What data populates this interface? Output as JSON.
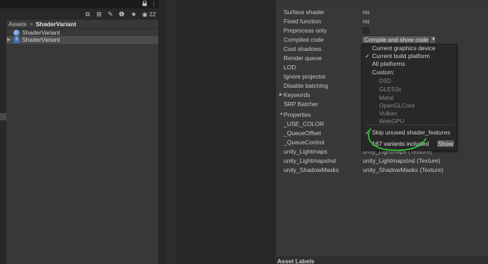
{
  "project": {
    "toolbar_count": "22",
    "breadcrumb": {
      "root": "Assets",
      "separator": ">",
      "current": "ShaderVariant"
    },
    "assets": [
      {
        "label": "ShaderVariant",
        "icon": "shader-variant-collection-icon"
      },
      {
        "label": "ShaderVariant",
        "icon": "shader-icon",
        "selected": true
      }
    ]
  },
  "inspector": {
    "properties": [
      {
        "label": "Surface shader",
        "value": "no"
      },
      {
        "label": "Fixed function",
        "value": "no"
      },
      {
        "label": "Preprocess only",
        "value": ""
      },
      {
        "label": "Compiled code",
        "value": ""
      },
      {
        "label": "Cast shadows",
        "value": ""
      },
      {
        "label": "Render queue",
        "value": ""
      },
      {
        "label": "LOD",
        "value": ""
      },
      {
        "label": "Ignore projector",
        "value": ""
      },
      {
        "label": "Disable batching",
        "value": ""
      },
      {
        "label": "Keywords",
        "value": ""
      },
      {
        "label": "SRP Batcher",
        "value": ""
      },
      {
        "label": "Properties",
        "value": ""
      },
      {
        "label": "_USE_COLOR",
        "value": ""
      },
      {
        "label": "_QueueOffset",
        "value": ""
      },
      {
        "label": "_QueueControl",
        "value": ""
      },
      {
        "label": "unity_Lightmaps",
        "value": "unity_Lightmaps (Texture)"
      },
      {
        "label": "unity_LightmapsInd",
        "value": "unity_LightmapsInd (Texture)"
      },
      {
        "label": "unity_ShadowMasks",
        "value": "unity_ShadowMasks (Texture)"
      }
    ],
    "compile_button": "Compile and show code",
    "bottom_label": "Asset Labels"
  },
  "dropdown": {
    "items": [
      {
        "label": "Current graphics device",
        "checked": false,
        "disabled": false,
        "sub": false
      },
      {
        "label": "Current build platform",
        "checked": true,
        "disabled": false,
        "sub": false
      },
      {
        "label": "All platforms",
        "checked": false,
        "disabled": false,
        "sub": false
      },
      {
        "label": "Custom:",
        "checked": false,
        "disabled": false,
        "sub": false
      },
      {
        "label": "D3D",
        "checked": false,
        "disabled": true,
        "sub": true
      },
      {
        "label": "GLES3x",
        "checked": false,
        "disabled": true,
        "sub": true
      },
      {
        "label": "Metal",
        "checked": false,
        "disabled": true,
        "sub": true
      },
      {
        "label": "OpenGLCore",
        "checked": false,
        "disabled": true,
        "sub": true
      },
      {
        "label": "Vulkan",
        "checked": false,
        "disabled": true,
        "sub": true
      },
      {
        "label": "WebGPU",
        "checked": false,
        "disabled": true,
        "sub": true
      }
    ],
    "skip_unused": "Skip unused shader_features",
    "variants_included": "167 variants included",
    "show_button": "Show",
    "highlight_color": "#2ecc2e"
  }
}
